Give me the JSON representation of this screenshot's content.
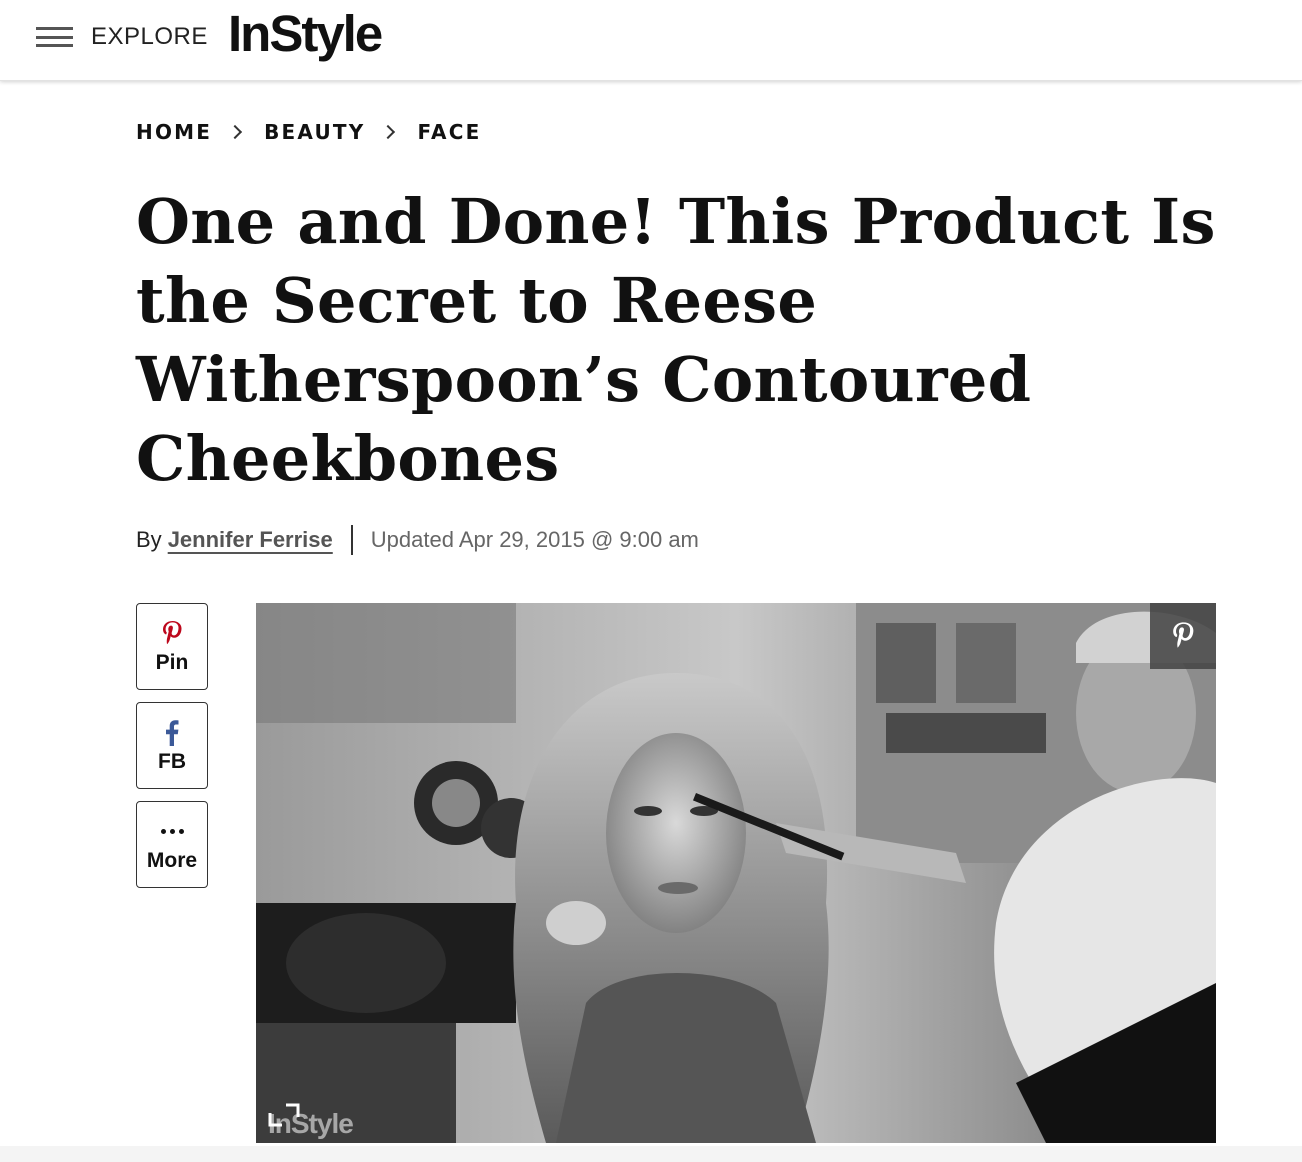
{
  "header": {
    "menu_label": "EXPLORE",
    "logo_text": "InStyle"
  },
  "breadcrumb": {
    "items": [
      "HOME",
      "BEAUTY",
      "FACE"
    ]
  },
  "article": {
    "headline": "One and Done! This Product Is the Secret to Reese Witherspoon’s Contoured Cheekbones",
    "byline_prefix": "By",
    "author": "Jennifer Ferrise",
    "updated": "Updated Apr 29, 2015 @ 9:00 am"
  },
  "share": {
    "pin_label": "Pin",
    "fb_label": "FB",
    "more_label": "More",
    "pin_icon": "pinterest-icon",
    "fb_icon": "facebook-icon",
    "more_icon": "more-dots-icon"
  },
  "hero": {
    "watermark": "InStyle",
    "overlay_icon": "pinterest-icon",
    "expand_icon": "expand-icon"
  },
  "colors": {
    "pinterest_red": "#bd081c",
    "facebook_blue": "#3b5998",
    "text": "#111111"
  }
}
